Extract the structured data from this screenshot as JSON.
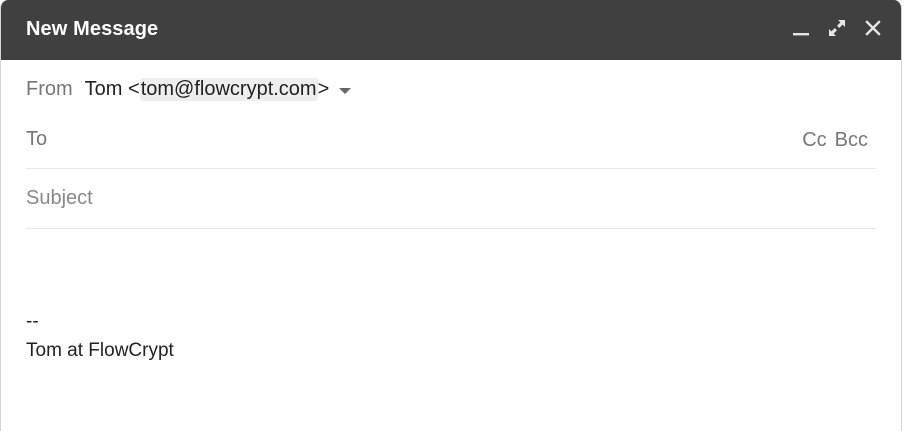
{
  "window": {
    "title": "New Message",
    "minimize_icon": "minimize-icon",
    "expand_icon": "expand-icon",
    "close_icon": "close-icon"
  },
  "from": {
    "label": "From",
    "name_prefix": "Tom <",
    "email": "tom@flowcrypt.com",
    "suffix": ">"
  },
  "to": {
    "label": "To",
    "cc": "Cc",
    "bcc": "Bcc"
  },
  "subject": {
    "placeholder": "Subject",
    "value": ""
  },
  "body": {
    "signature_separator": "--",
    "signature": "Tom at FlowCrypt"
  },
  "colors": {
    "titlebar_bg": "#404040",
    "titlebar_text": "#ffffff"
  }
}
